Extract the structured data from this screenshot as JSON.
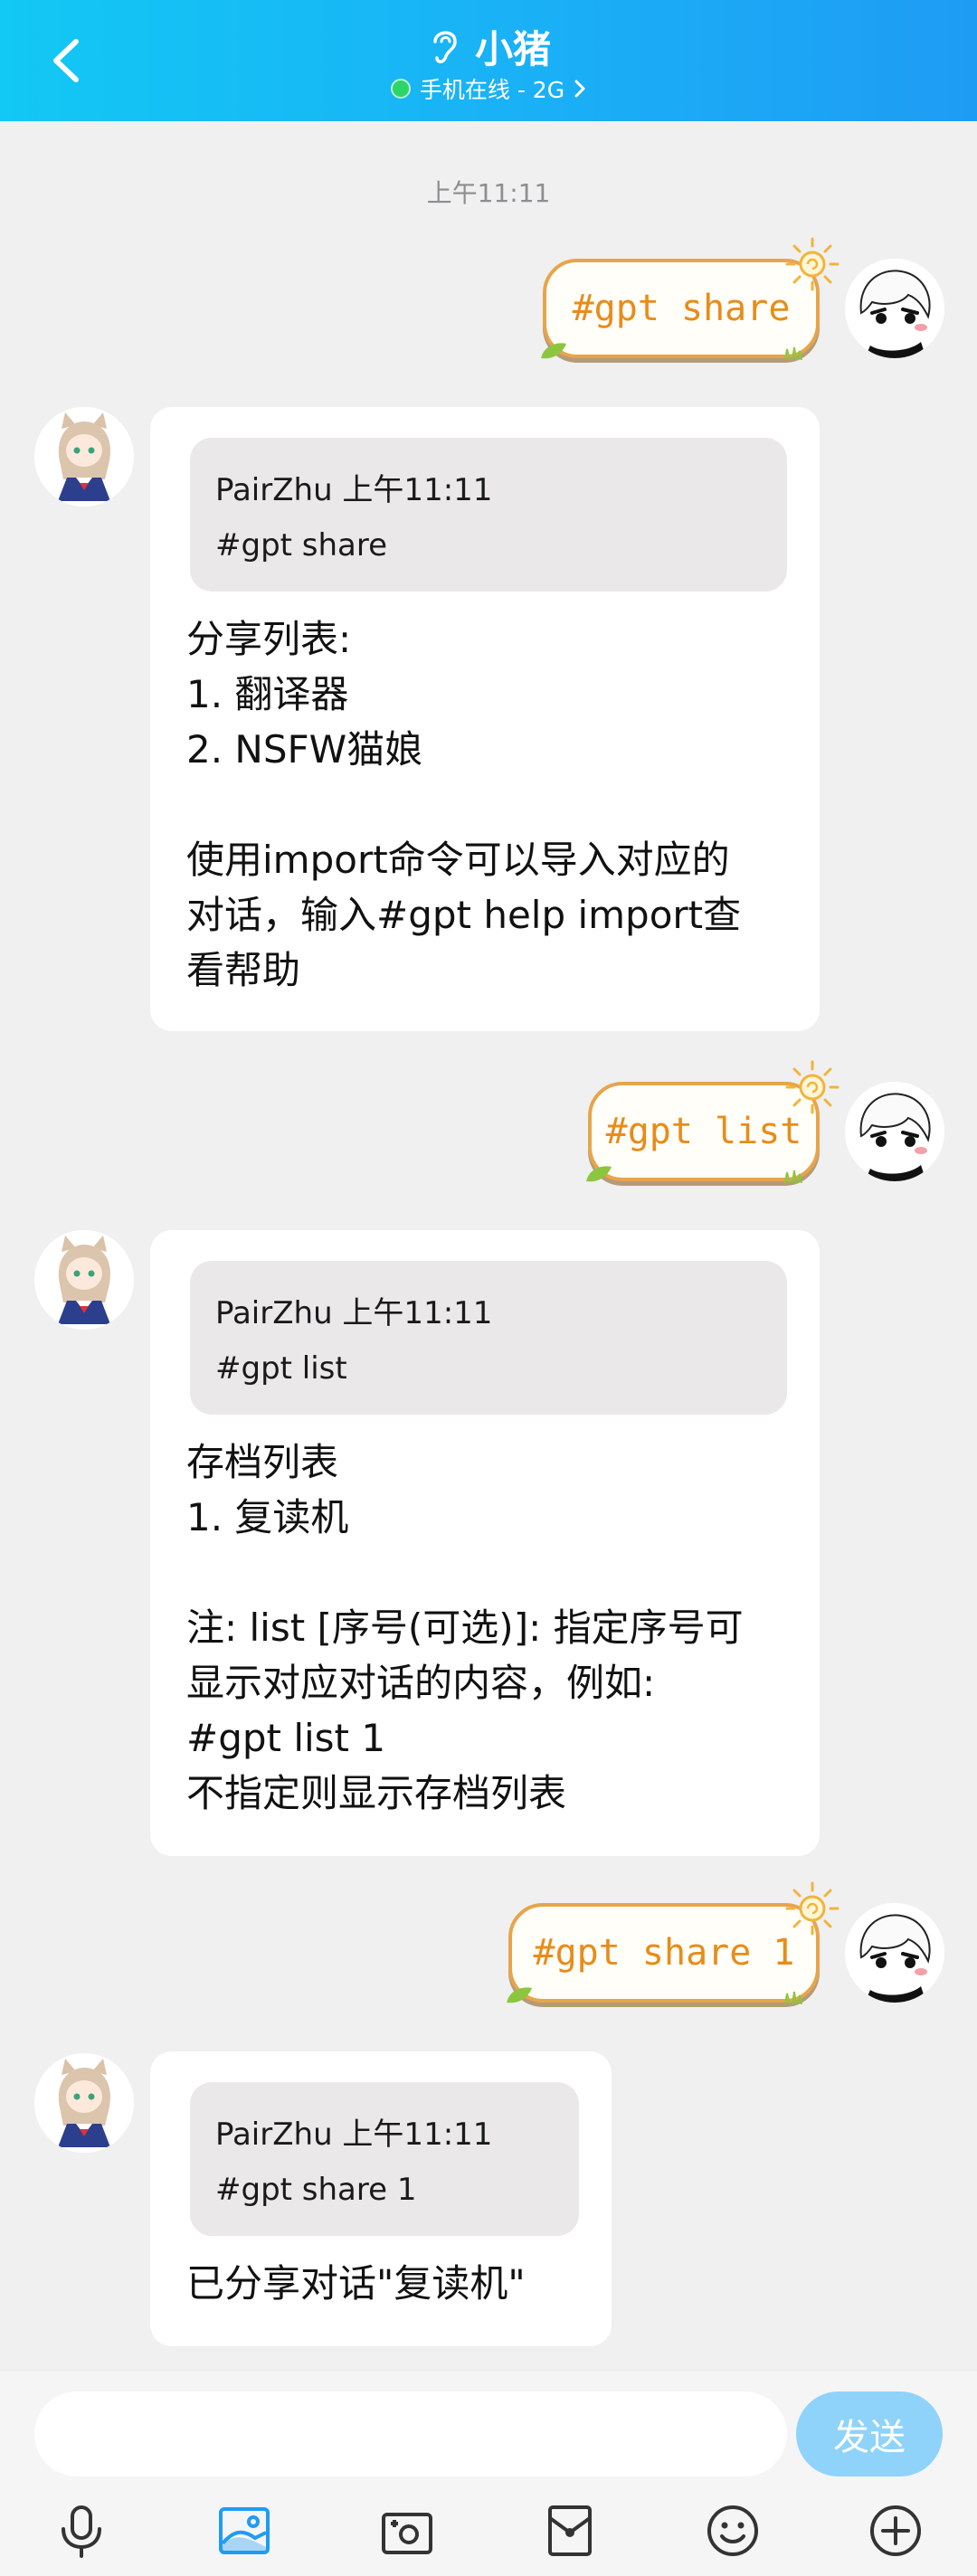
{
  "header": {
    "title": "小猪",
    "status": "手机在线 - 2G",
    "status_color": "#2bd56a",
    "icons": [
      "back-arrow-icon",
      "ear-icon",
      "chevron-right-icon"
    ]
  },
  "chat": {
    "time_label": "上午11:11",
    "messages": [
      {
        "type": "sent",
        "text": "#gpt share"
      },
      {
        "type": "received",
        "quote_head": "PairZhu 上午11:11",
        "quote_body": "#gpt share",
        "reply": "分享列表:\n1. 翻译器\n2. NSFW猫娘\n\n使用import命令可以导入对应的\n对话，输入#gpt help import查\n看帮助"
      },
      {
        "type": "sent",
        "text": "#gpt list"
      },
      {
        "type": "received",
        "quote_head": "PairZhu 上午11:11",
        "quote_body": "#gpt list",
        "reply": "存档列表\n1. 复读机\n\n注: list [序号(可选)]: 指定序号可\n显示对应对话的内容，例如:\n#gpt list 1\n不指定则显示存档列表"
      },
      {
        "type": "sent",
        "text": "#gpt share 1"
      },
      {
        "type": "received",
        "quote_head": "PairZhu 上午11:11",
        "quote_body": "#gpt share 1",
        "reply": "已分享对话\"复读机\""
      }
    ]
  },
  "input": {
    "value": "",
    "placeholder": "",
    "send_label": "发送",
    "send_color": "#8fd3fb"
  },
  "toolbar": {
    "icons": [
      "microphone-icon",
      "image-icon",
      "camera-icon",
      "red-packet-icon",
      "emoji-icon",
      "plus-icon"
    ],
    "active_icon_color": "#1e9cf4"
  }
}
